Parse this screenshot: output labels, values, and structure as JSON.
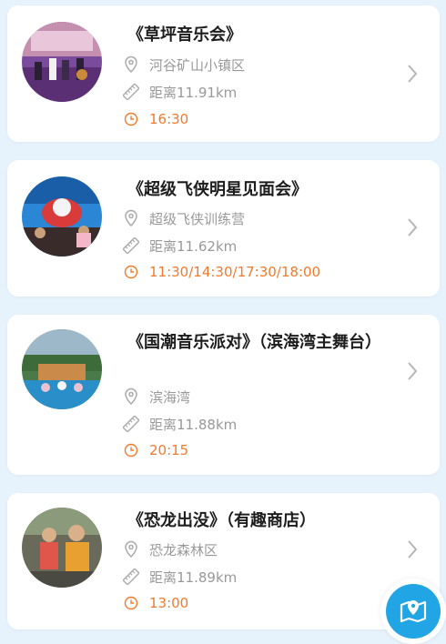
{
  "events": [
    {
      "title": "《草坪音乐会》",
      "location": "河谷矿山小镇区",
      "distance": "距离11.91km",
      "time": "16:30"
    },
    {
      "title": "《超级飞侠明星见面会》",
      "location": "超级飞侠训练营",
      "distance": "距离11.62km",
      "time": "11:30/14:30/17:30/18:00"
    },
    {
      "title": "《国潮音乐派对》（滨海湾主舞台）",
      "location": "滨海湾",
      "distance": "距离11.88km",
      "time": "20:15"
    },
    {
      "title": "《恐龙出没》（有趣商店）",
      "location": "恐龙森林区",
      "distance": "距离11.89km",
      "time": "13:00"
    }
  ],
  "icons": {
    "location": "location-pin-icon",
    "distance": "ruler-icon",
    "time": "clock-icon",
    "chevron": "chevron-right-icon",
    "map_button": "map-location-icon"
  },
  "colors": {
    "background": "#e6f2fc",
    "time_accent": "#f07b2d",
    "map_button": "#22a5e4"
  }
}
